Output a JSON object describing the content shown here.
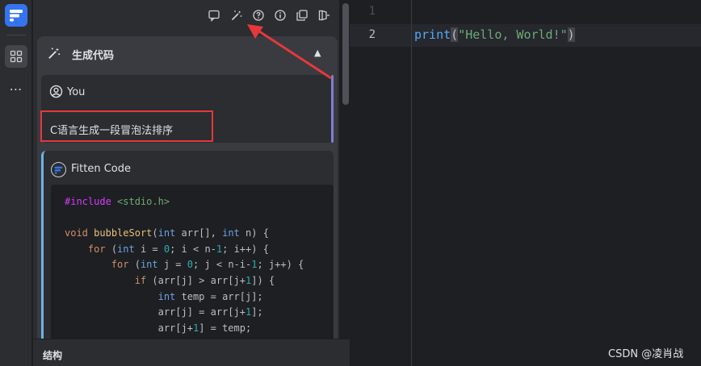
{
  "activity_bar": {
    "icons": [
      "fitten-logo-icon",
      "structure-icon",
      "more-icon"
    ],
    "more_label": "⋯"
  },
  "toolbar": {
    "icons": [
      "chat-icon",
      "magic-wand-icon",
      "help-icon",
      "info-icon",
      "copy-window-icon",
      "exit-icon"
    ]
  },
  "card": {
    "title": "生成代码",
    "collapse_glyph": "▲"
  },
  "user_message": {
    "sender": "You",
    "text": "C语言生成一段冒泡法排序"
  },
  "assistant_message": {
    "sender": "Fitten Code"
  },
  "structure_panel": {
    "label": "结构"
  },
  "editor": {
    "line_numbers": [
      "1",
      "2"
    ],
    "code": {
      "fn": "print",
      "open": "(",
      "str": "\"Hello, World!\"",
      "close": ")"
    }
  },
  "watermark": "CSDN @凌肖战",
  "colors": {
    "accent": "#3574f0",
    "highlight_box": "#e5383b",
    "annotation_arrow": "#e5383b"
  }
}
